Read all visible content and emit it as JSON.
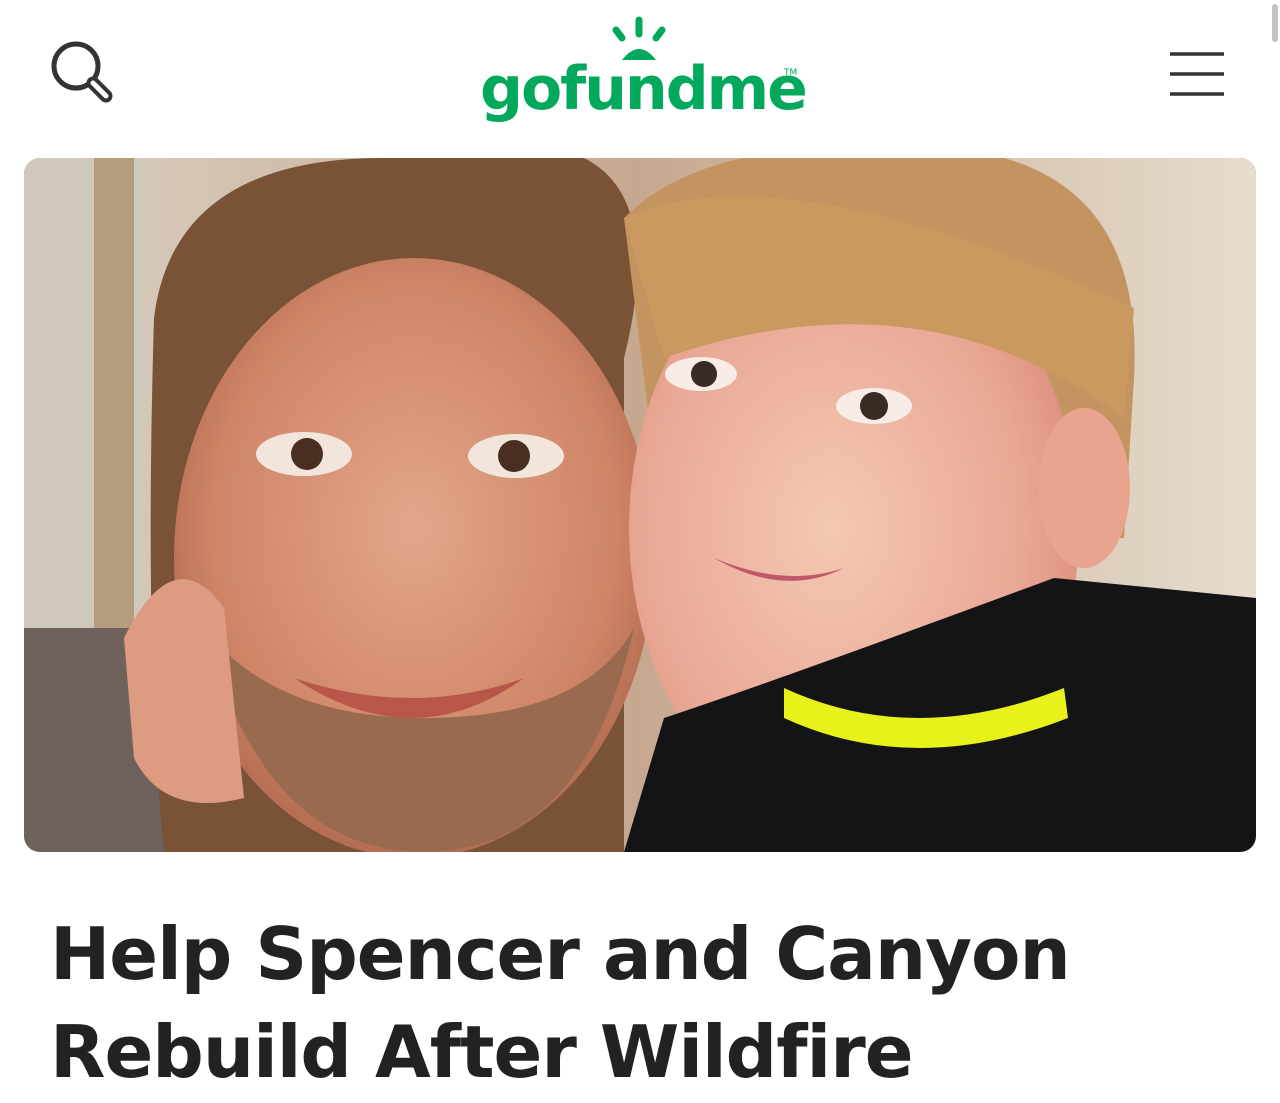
{
  "header": {
    "logo_text": "gofundme",
    "logo_tm": "TM",
    "search_icon": "search-icon",
    "menu_icon": "hamburger-menu-icon"
  },
  "campaign": {
    "title": "Help Spencer and Canyon Rebuild After Wildfire",
    "photo_subject": "photo"
  },
  "colors": {
    "brand": "#02a95c",
    "title": "#222222",
    "icon": "#333333",
    "accent_shirt_collar": "#e8f21a"
  }
}
